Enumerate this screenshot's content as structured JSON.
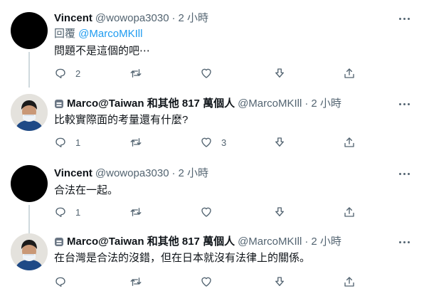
{
  "tweets": [
    {
      "name": "Vincent",
      "handle": "@wowopa3030",
      "sep": "·",
      "time": "2 小時",
      "reply_prefix": "回覆 ",
      "reply_to": "@MarcoMKIll",
      "text": "問題不是這個的吧⋯",
      "reply_count": "2",
      "retweet_count": "",
      "like_count": ""
    },
    {
      "name": "Marco@Taiwan 和其他 817 萬個人",
      "handle": "@MarcoMKIll",
      "sep": "·",
      "time": "2 小時",
      "text": "比較實際面的考量還有什麼?",
      "reply_count": "1",
      "retweet_count": "",
      "like_count": "3"
    },
    {
      "name": "Vincent",
      "handle": "@wowopa3030",
      "sep": "·",
      "time": "2 小時",
      "text": "合法在一起。",
      "reply_count": "1",
      "retweet_count": "",
      "like_count": ""
    },
    {
      "name": "Marco@Taiwan 和其他 817 萬個人",
      "handle": "@MarcoMKIll",
      "sep": "·",
      "time": "2 小時",
      "text": "在台灣是合法的沒錯，但在日本就沒有法律上的關係。",
      "reply_count": "",
      "retweet_count": "",
      "like_count": ""
    }
  ],
  "icons": {
    "reply": "reply-icon",
    "retweet": "retweet-icon",
    "like": "heart-icon",
    "download": "download-icon",
    "share": "share-icon",
    "more": "more-icon",
    "badge": "robot-icon"
  },
  "colors": {
    "link": "#1d9bf0",
    "secondary": "#536471",
    "thread_line": "#cfd9de",
    "text": "#0f1419"
  }
}
